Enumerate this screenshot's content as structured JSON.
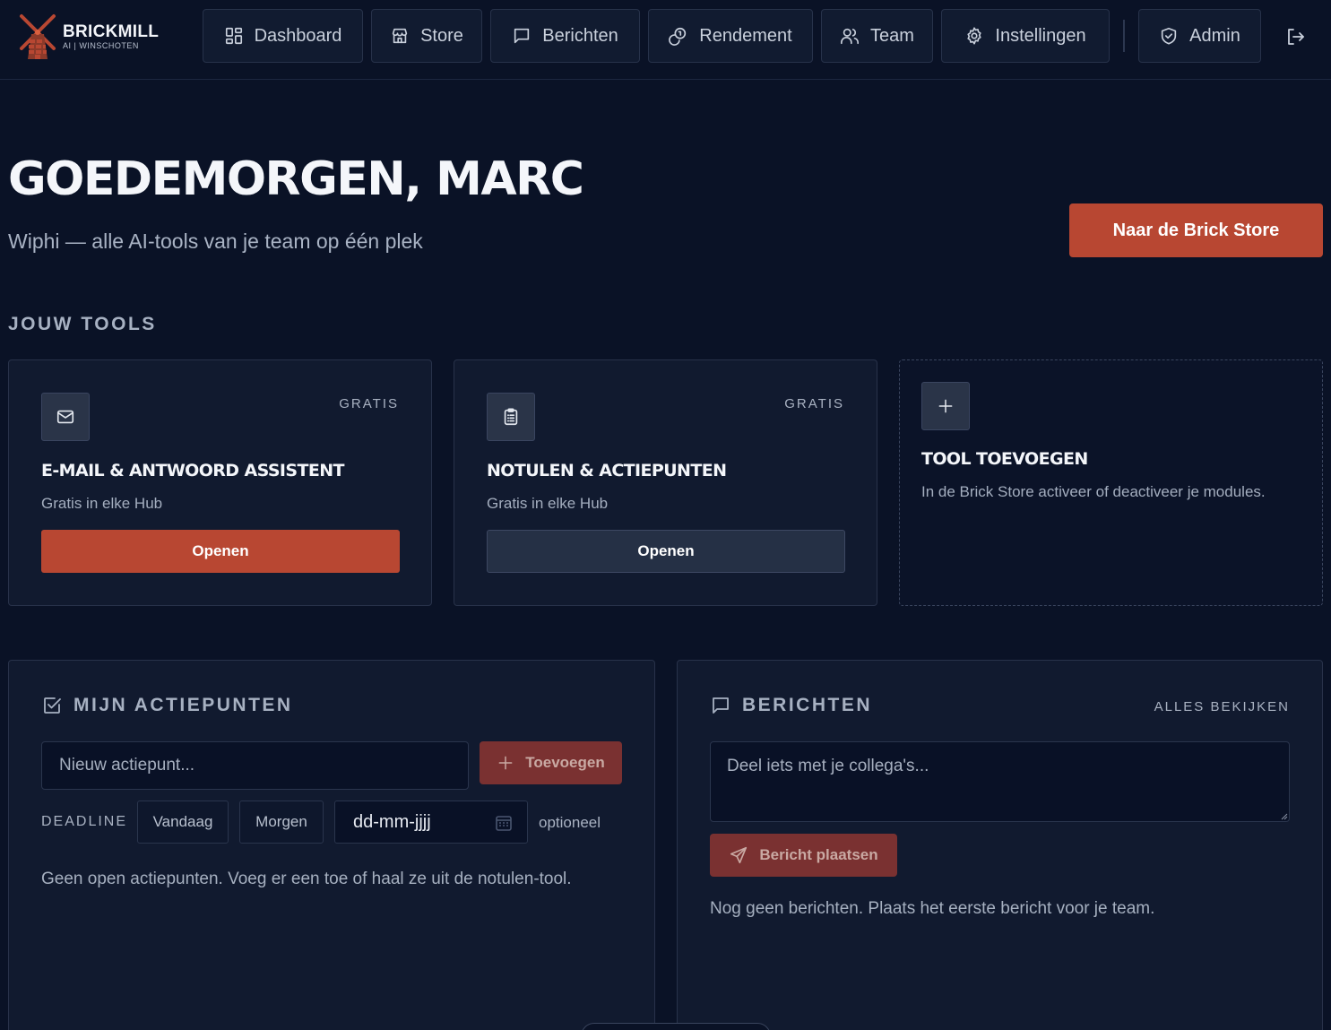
{
  "brand": {
    "name": "BRICKMILL",
    "sub": "AI | WINSCHOTEN",
    "accent": "#b84732"
  },
  "nav": {
    "dashboard": "Dashboard",
    "store": "Store",
    "berichten": "Berichten",
    "rendement": "Rendement",
    "team": "Team",
    "instellingen": "Instellingen",
    "admin": "Admin"
  },
  "hero": {
    "greeting": "GOEDEMORGEN, MARC",
    "subtitle": "Wiphi — alle AI-tools van je team op één plek",
    "cta": "Naar de Brick Store"
  },
  "tools": {
    "section_title": "JOUW TOOLS",
    "items": [
      {
        "icon": "mail-icon",
        "badge": "GRATIS",
        "title": "E-MAIL & ANTWOORD ASSISTENT",
        "desc": "Gratis in elke Hub",
        "button": "Openen"
      },
      {
        "icon": "clipboard-icon",
        "badge": "GRATIS",
        "title": "NOTULEN & ACTIEPUNTEN",
        "desc": "Gratis in elke Hub",
        "button": "Openen"
      }
    ],
    "add": {
      "title": "TOOL TOEVOEGEN",
      "desc": "In de Brick Store activeer of deactiveer je modules."
    }
  },
  "actions": {
    "title": "MIJN ACTIEPUNTEN",
    "input_placeholder": "Nieuw actiepunt...",
    "add_button": "Toevoegen",
    "deadline_label": "DEADLINE",
    "today": "Vandaag",
    "tomorrow": "Morgen",
    "date_placeholder": "dd-mm-jjjj",
    "optional": "optioneel",
    "empty": "Geen open actiepunten. Voeg er een toe of haal ze uit de notulen-tool."
  },
  "messages": {
    "title": "BERICHTEN",
    "see_all": "ALLES BEKIJKEN",
    "placeholder": "Deel iets met je collega's...",
    "post_button": "Bericht plaatsen",
    "empty": "Nog geen berichten. Plaats het eerste bericht voor je team."
  }
}
